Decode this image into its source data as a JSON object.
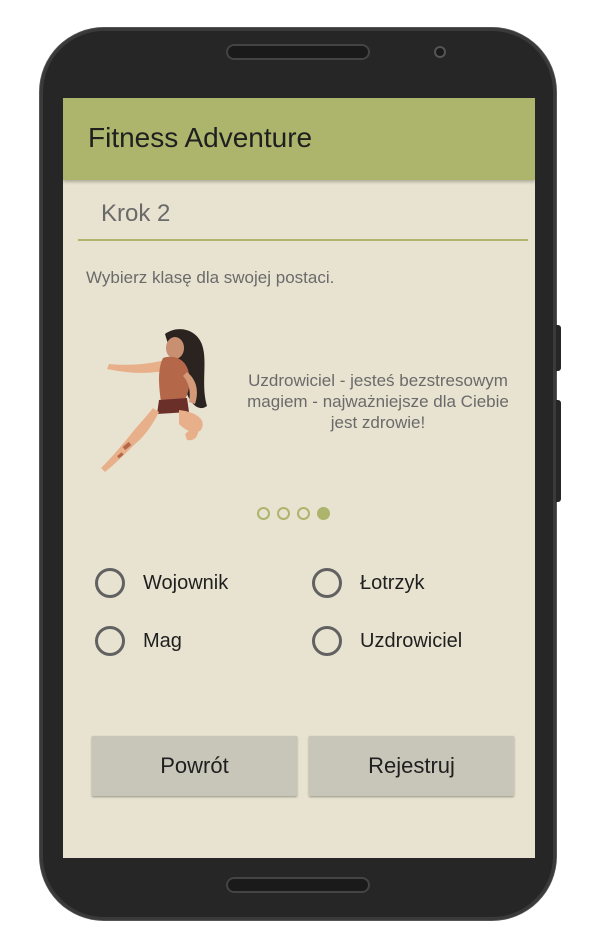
{
  "app": {
    "title": "Fitness Adventure"
  },
  "step": {
    "title": "Krok 2"
  },
  "instruction": "Wybierz klasę dla swojej postaci.",
  "carousel": {
    "description": "Uzdrowiciel - jesteś bezstresowym magiem - najważniejsze dla Ciebie jest zdrowie!",
    "image_icon": "healer-character-illustration",
    "page_count": 4,
    "active_index": 3
  },
  "classes": [
    {
      "label": "Wojownik",
      "selected": false
    },
    {
      "label": "Łotrzyk",
      "selected": false
    },
    {
      "label": "Mag",
      "selected": false
    },
    {
      "label": "Uzdrowiciel",
      "selected": false
    }
  ],
  "buttons": {
    "back_label": "Powrót",
    "register_label": "Rejestruj"
  },
  "colors": {
    "accent": "#adb46c",
    "background": "#e8e3d0",
    "button": "#c8c5b9",
    "text_muted": "#6a6a6a"
  }
}
